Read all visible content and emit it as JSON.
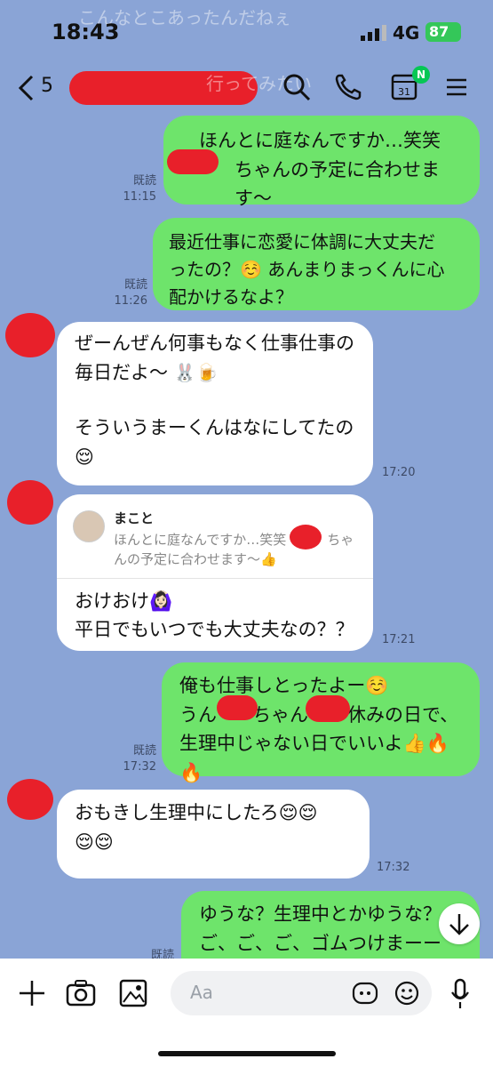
{
  "status": {
    "time": "18:43",
    "network": "4G",
    "battery": "87"
  },
  "header": {
    "back_count": "5"
  },
  "ghost_text": {
    "top": "こんなとこあったんだねぇ",
    "search": "行ってみたい"
  },
  "messages": [
    {
      "side": "right",
      "lines": [
        "ほんとに庭なんですか…笑笑",
        "ちゃんの予定に合わせます〜",
        "👍"
      ],
      "read": "既読",
      "time": "11:15"
    },
    {
      "side": "right",
      "lines": [
        "最近仕事に恋愛に体調に大丈夫だ",
        "ったの？☺️ あんまりまっくんに心",
        "配かけるなよ？"
      ],
      "read": "既読",
      "time": "11:26"
    },
    {
      "side": "left",
      "lines": [
        "ぜーんぜん何事もなく仕事仕事の",
        "毎日だよ〜",
        "",
        "そういうまーくんはなにしてたの",
        "😌"
      ],
      "time": "17:20"
    },
    {
      "side": "left",
      "reply_name": "まこと",
      "reply_lines": [
        "ほんとに庭なんですか…笑笑",
        "ちゃ",
        "んの予定に合わせます〜👍"
      ],
      "lines": [
        "おけおけ🙆🏻‍♀️",
        "平日でもいつでも大丈夫なの？？"
      ],
      "time": "17:21"
    },
    {
      "side": "right",
      "lines": [
        "俺も仕事しとったよー☺️",
        "うん",
        "ちゃん",
        "休みの日で、",
        "生理中じゃない日でいいよ👍🔥",
        "🔥"
      ],
      "read": "既読",
      "time": "17:32"
    },
    {
      "side": "left",
      "lines": [
        "おもきし生理中にしたろ😌😌",
        "😌😌"
      ],
      "time": "17:32"
    },
    {
      "side": "right",
      "lines": [
        "ゆうな？生理中とかゆうな？",
        "ご、ご、ご、ゴムつけまーー",
        "す！"
      ],
      "read": "既読"
    }
  ],
  "input": {
    "placeholder": "Aa"
  },
  "colors": {
    "bg": "#8aa4d6",
    "green": "#6ee46b",
    "white": "#ffffff",
    "redact": "#e8202a"
  }
}
